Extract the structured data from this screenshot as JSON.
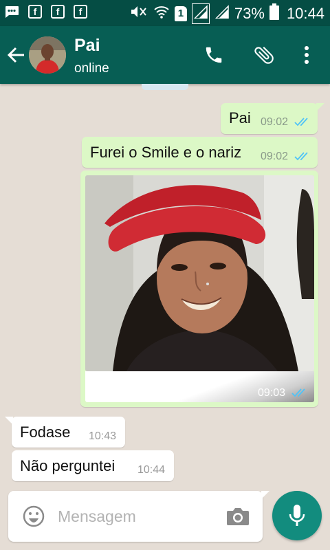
{
  "status_bar": {
    "battery_percent": "73%",
    "time": "10:44",
    "icons": [
      "message-icon",
      "facebook-icon",
      "facebook-icon",
      "facebook-icon",
      "mute-icon",
      "wifi-icon",
      "sim1-icon",
      "signal-icon",
      "signal-icon",
      "battery-icon"
    ],
    "fb_letter": "f",
    "sim_label": "1"
  },
  "header": {
    "contact_name": "Pai",
    "contact_status": "online",
    "actions": [
      "back-arrow-icon",
      "phone-icon",
      "paperclip-icon",
      "more-vert-icon"
    ]
  },
  "messages": [
    {
      "direction": "out",
      "text": "Pai",
      "time": "09:02",
      "read": true
    },
    {
      "direction": "out",
      "text": "Furei o Smile e o nariz",
      "time": "09:02",
      "read": true
    },
    {
      "direction": "out",
      "type": "image",
      "time": "09:03",
      "read": true
    },
    {
      "direction": "in",
      "text": "Fodase",
      "time": "10:43"
    },
    {
      "direction": "in",
      "text": "Não perguntei",
      "time": "10:44"
    }
  ],
  "composer": {
    "placeholder": "Mensagem",
    "icons": [
      "emoji-icon",
      "camera-icon",
      "mic-icon"
    ]
  },
  "colors": {
    "header": "#075e54",
    "status_bar": "#054d44",
    "outgoing_bubble": "#dcf8c6",
    "incoming_bubble": "#ffffff",
    "chat_background": "#e5ddd5",
    "read_ticks": "#4fc3f7",
    "mic_button": "#128c7e"
  }
}
